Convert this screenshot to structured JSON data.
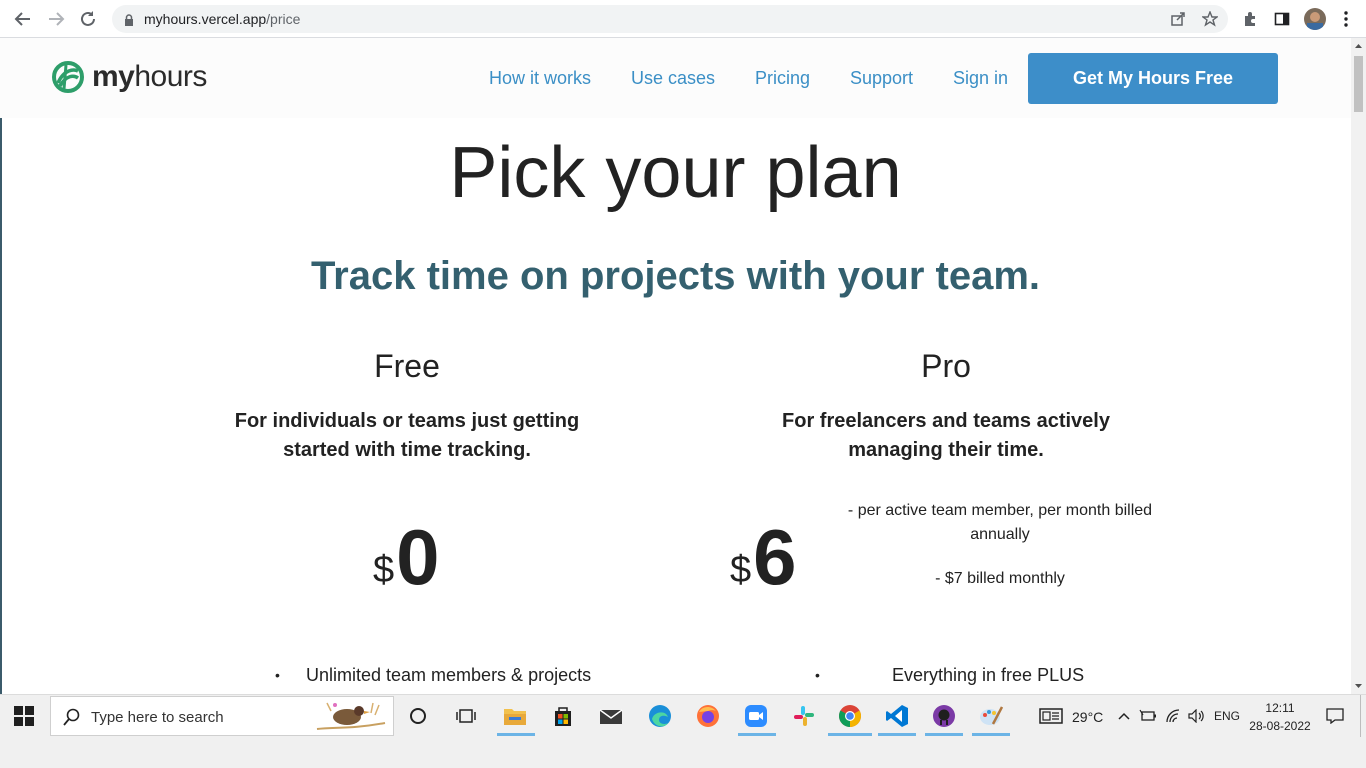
{
  "browser": {
    "url_host": "myhours.vercel.app",
    "url_path": "/price"
  },
  "header": {
    "brand_my": "my",
    "brand_hours": "hours",
    "nav": [
      {
        "label": "How it works"
      },
      {
        "label": "Use cases"
      },
      {
        "label": "Pricing"
      },
      {
        "label": "Support"
      },
      {
        "label": "Sign in"
      }
    ],
    "cta_label": "Get My Hours Free"
  },
  "main": {
    "title": "Pick your plan",
    "subtitle": "Track time on projects with your team.",
    "plans": [
      {
        "name": "Free",
        "desc_line1": "For individuals or teams just getting",
        "desc_line2": "started with time tracking.",
        "currency": "$",
        "price": "0",
        "feature": "Unlimited team members & projects"
      },
      {
        "name": "Pro",
        "desc_line1": "For freelancers and teams actively",
        "desc_line2": "managing their time.",
        "currency": "$",
        "price": "6",
        "note_line1": "- per active team member, per month billed",
        "note_line2": "annually",
        "note_monthly": "- $7 billed monthly",
        "feature": "Everything in free PLUS"
      }
    ],
    "bullet": "•"
  },
  "taskbar": {
    "search_placeholder": "Type here to search",
    "temperature": "29°C",
    "language": "ENG",
    "time": "12:11",
    "date": "28-08-2022"
  },
  "colors": {
    "accent": "#3d8ec9",
    "link": "#3b8fc6",
    "subtitle": "#34606f",
    "brand_green": "#2e9e6a"
  }
}
